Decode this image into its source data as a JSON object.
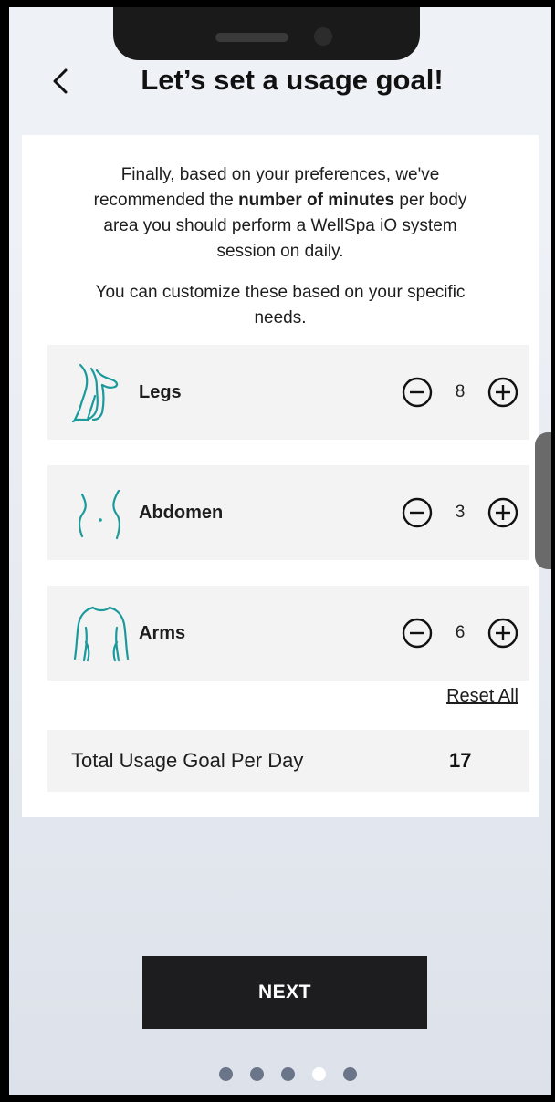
{
  "header": {
    "title": "Let’s set a usage goal!"
  },
  "intro": {
    "line_before_bold": "Finally, based on your preferences, we've recommended the ",
    "bold": "number of minutes",
    "line_after_bold": " per body area you should perform a WellSpa iO system session on daily.",
    "customize": "You can customize these based on your specific needs."
  },
  "areas": [
    {
      "label": "Legs",
      "value": "8",
      "icon": "legs-icon"
    },
    {
      "label": "Abdomen",
      "value": "3",
      "icon": "abdomen-icon"
    },
    {
      "label": "Arms",
      "value": "6",
      "icon": "arms-icon"
    }
  ],
  "reset_label": "Reset All",
  "total": {
    "label": "Total Usage Goal Per Day",
    "value": "17"
  },
  "next_label": "NEXT",
  "pagination": {
    "count": 5,
    "active_index": 3
  },
  "colors": {
    "accent_teal": "#1a9a9c",
    "button_dark": "#1d1d1f",
    "dot_inactive": "#6b7589",
    "dot_active": "#ffffff"
  }
}
